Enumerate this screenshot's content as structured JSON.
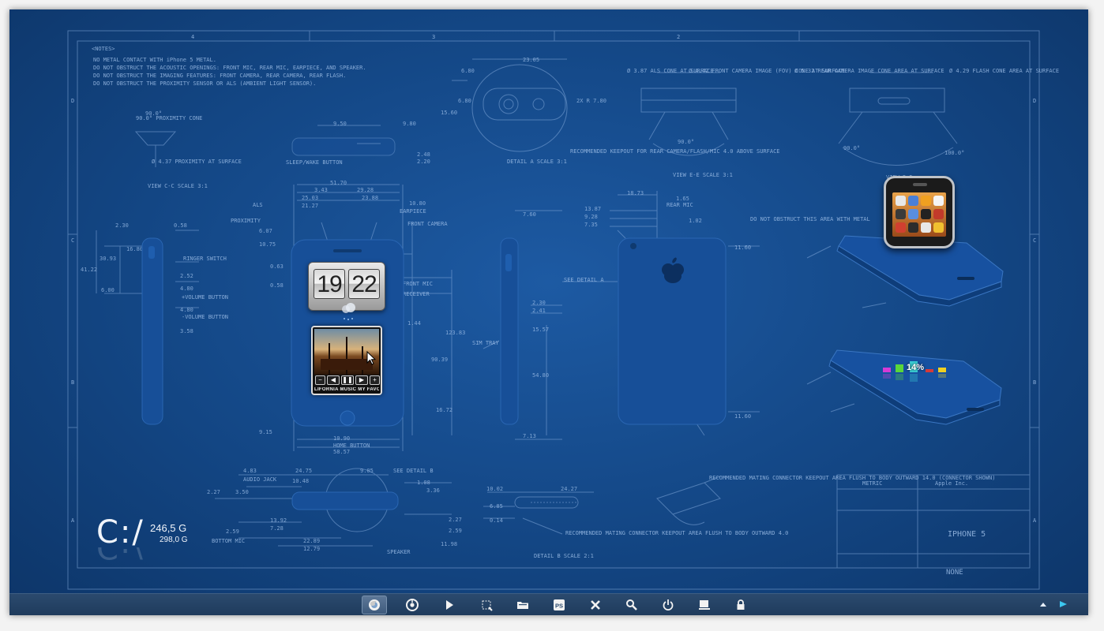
{
  "notes": {
    "header": "<NOTES>",
    "items": [
      "NO METAL CONTACT WITH iPhone 5 METAL.",
      "DO NOT OBSTRUCT THE ACOUSTIC OPENINGS: FRONT MIC, REAR MIC, EARPIECE, AND SPEAKER.",
      "DO NOT OBSTRUCT THE IMAGING FEATURES: FRONT CAMERA, REAR CAMERA, REAR FLASH.",
      "DO NOT OBSTRUCT THE PROXIMITY SENSOR OR ALS (AMBIENT LIGHT SENSOR)."
    ]
  },
  "blueprint": {
    "zones_top": [
      "4",
      "3",
      "2"
    ],
    "zones_left": [
      "D",
      "C",
      "B",
      "A"
    ],
    "zones_right": [
      "D",
      "C",
      "B",
      "A"
    ],
    "labels": {
      "proximity_cone": "90.0° PROXIMITY CONE",
      "proximity_surface": "Ø 4.37 PROXIMITY AT SURFACE",
      "view_cc": "VIEW C-C SCALE 3:1",
      "sleep_wake": "SLEEP/WAKE BUTTON",
      "detail_a": "DETAIL A SCALE 3:1",
      "recommended_keepout": "RECOMMENDED KEEPOUT FOR REAR CAMERA/FLASH/MIC 4.0 ABOVE SURFACE",
      "als_cone": "Ø 3.87 ALS CONE AT SURFACE",
      "front_camera_cone": "Ø 4.42 FRONT CAMERA IMAGE (FOV) CONE AT SURFACE",
      "view_ee": "VIEW E-E SCALE 3:1",
      "rear_camera_cone": "Ø 5.32 REAR CAMERA IMAGE CONE AREA AT SURFACE",
      "flash_cone": "Ø 4.29 FLASH CONE AREA AT SURFACE",
      "view_dd": "VIEW D-D",
      "als": "ALS",
      "proximity": "PROXIMITY",
      "earpiece": "EARPIECE",
      "front_camera": "FRONT CAMERA",
      "front_mic": "FRONT MIC",
      "receiver": "RECEIVER",
      "ringer_switch": "RINGER SWITCH",
      "volume_button": "+VOLUME BUTTON",
      "volume_minus": "-VOLUME BUTTON",
      "sim_tray": "SIM TRAY",
      "home_button": "HOME BUTTON",
      "rear_mic": "REAR MIC",
      "see_detail_a": "SEE DETAIL A",
      "do_not_obstruct": "DO NOT OBSTRUCT THIS AREA WITH METAL",
      "audio_jack": "AUDIO JACK",
      "bottom_mic": "BOTTOM MIC",
      "speaker": "SPEAKER",
      "see_detail_b": "SEE DETAIL B",
      "detail_b": "DETAIL B SCALE 2:1",
      "recommended_mating": "RECOMMENDED MATING CONNECTOR KEEPOUT AREA FLUSH TO BODY OUTWARD 4.0",
      "recommended_mating2": "RECOMMENDED MATING CONNECTOR KEEPOUT AREA FLUSH TO BODY OUTWARD 14.0 (CONNECTOR SHOWN)",
      "title_company": "Apple Inc.",
      "title_name": "IPHONE 5",
      "title_none": "NONE",
      "metric": "METRIC"
    },
    "dims": [
      "23.05",
      "6.80",
      "6.80",
      "15.60",
      "2X R 7.80",
      "9.50",
      "9.80",
      "2.48",
      "2.20",
      "51.70",
      "3.43",
      "29.28",
      "25.03",
      "23.88",
      "21.27",
      "10.80",
      "6.07",
      "10.75",
      "2.30",
      "0.58",
      "16.80",
      "30.93",
      "41.22",
      "6.00",
      "2.52",
      "4.80",
      "4.80",
      "3.58",
      "0.63",
      "0.58",
      "7.60",
      "2.30",
      "2.41",
      "15.57",
      "54.80",
      "16.72",
      "9.15",
      "10.90",
      "58.57",
      "7.13",
      "18.73",
      "13.87",
      "9.28",
      "7.35",
      "1.65",
      "1.02",
      "11.60",
      "11.60",
      "4.83",
      "24.75",
      "10.48",
      "9.05",
      "2.27",
      "3.50",
      "13.92",
      "7.28",
      "2.59",
      "22.89",
      "12.79",
      "11.98",
      "1.08",
      "3.36",
      "2.27",
      "2.59",
      "10.02",
      "24.27",
      "6.85",
      "0.14",
      "1.44",
      "123.83",
      "90.39",
      "90.0°",
      "90.0°",
      "90.0°",
      "100.0°"
    ]
  },
  "clock": {
    "hours": "19",
    "minutes": "22"
  },
  "music": {
    "track": "LIFORNIA  MUSIC  MY FAVORITES"
  },
  "drive": {
    "letter": "C:/",
    "free": "246,5 G",
    "total": "298,0 G"
  },
  "cpu": {
    "percent": "14%"
  },
  "taskbar": {
    "buttons": [
      {
        "name": "firefox-icon",
        "active": true
      },
      {
        "name": "chrome-icon",
        "active": false
      },
      {
        "name": "media-play-icon",
        "active": false
      },
      {
        "name": "snipping-icon",
        "active": false
      },
      {
        "name": "explorer-icon",
        "active": false
      },
      {
        "name": "photoshop-icon",
        "active": false,
        "label": "PS"
      },
      {
        "name": "tools-icon",
        "active": false
      },
      {
        "name": "search-icon",
        "active": false
      },
      {
        "name": "power-icon",
        "active": false
      },
      {
        "name": "computer-icon",
        "active": false
      },
      {
        "name": "lock-icon",
        "active": false
      }
    ]
  },
  "colors": {
    "background": "#134684",
    "line": "#7fa6d8",
    "taskbar": "#24436a",
    "phone": "#174f98"
  }
}
